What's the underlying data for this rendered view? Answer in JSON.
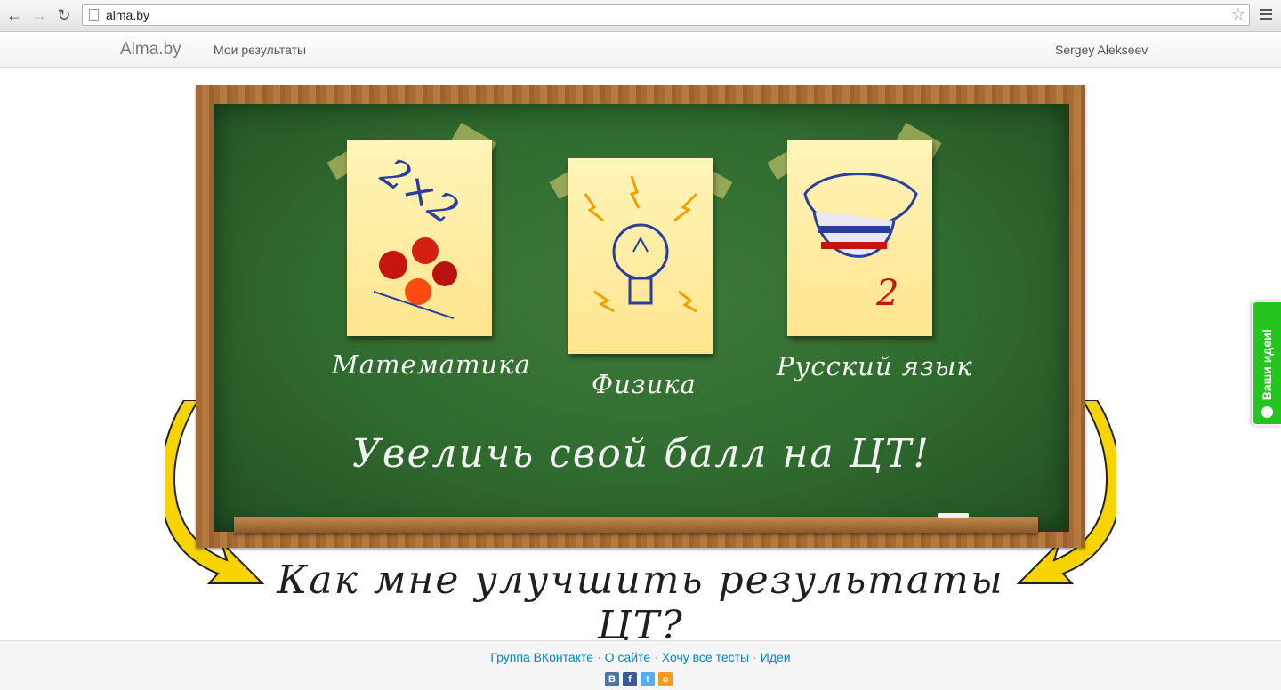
{
  "browser": {
    "url": "alma.by",
    "back_icon": "←",
    "forward_icon": "→",
    "reload_icon": "↻",
    "star_icon": "☆"
  },
  "navbar": {
    "brand": "Alma.by",
    "my_results": "Мои результаты",
    "user_name": "Sergey Alekseev"
  },
  "hero": {
    "subjects": [
      {
        "label": "Математика",
        "icon": "apples-2x2-icon"
      },
      {
        "label": "Физика",
        "icon": "lightbulb-icon"
      },
      {
        "label": "Русский язык",
        "icon": "tongue-icon"
      }
    ],
    "slogan": "Увеличь свой балл на ЦТ!",
    "question": "Как мне улучшить результаты ЦТ?"
  },
  "ideas_tab": {
    "label": "Ваши идеи!",
    "color": "#25c51f"
  },
  "footer": {
    "links": [
      "Группа ВКонтакте",
      "О сайте",
      "Хочу все тесты",
      "Идеи"
    ],
    "separator": "·",
    "share": [
      {
        "name": "vk",
        "glyph": "В",
        "color": "#4c75a3"
      },
      {
        "name": "facebook",
        "glyph": "f",
        "color": "#3b5998"
      },
      {
        "name": "twitter",
        "glyph": "t",
        "color": "#55acee"
      },
      {
        "name": "odnoklassniki",
        "glyph": "о",
        "color": "#f59a1a"
      }
    ]
  }
}
